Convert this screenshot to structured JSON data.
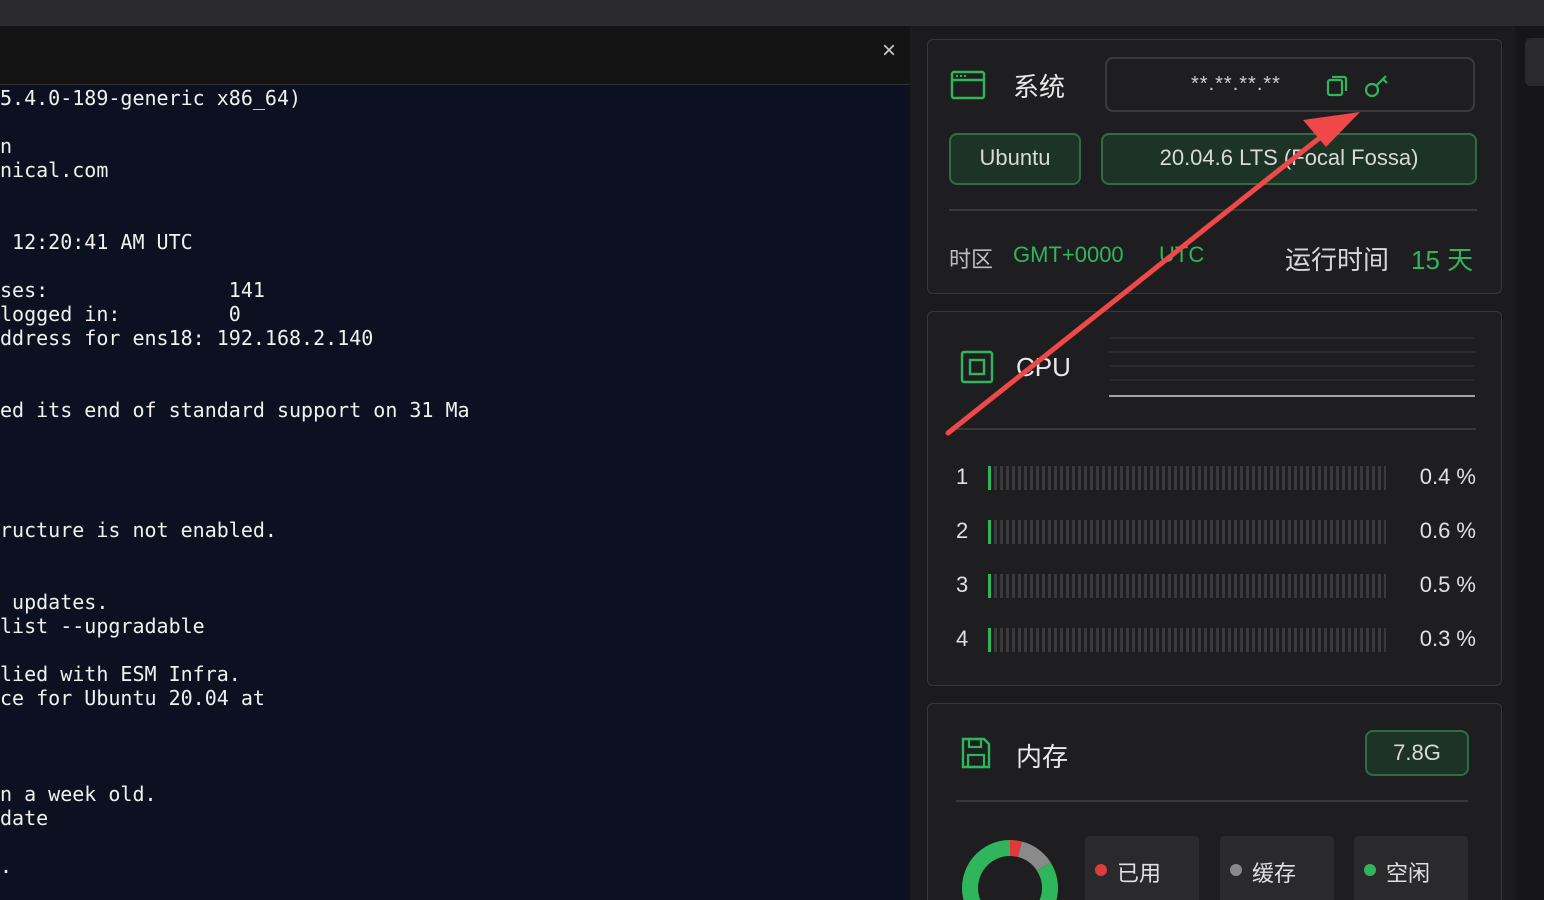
{
  "terminal": {
    "close_icon": "×",
    "lines": [
      "5.4.0-189-generic x86_64)",
      "n",
      "nical.com",
      " 12:20:41 AM UTC",
      "ses:               141",
      "logged in:         0",
      "ddress for ens18: 192.168.2.140",
      "ed its end of standard support on 31 Ma",
      "ructure is not enabled.",
      " updates.",
      "list --upgradable",
      "lied with ESM Infra.",
      "ce for Ubuntu 20.04 at",
      "n a week old.",
      "date",
      "."
    ]
  },
  "system": {
    "title": "系统",
    "ip_masked": "**.**.**.**",
    "os_name": "Ubuntu",
    "os_version": "20.04.6 LTS (Focal Fossa)",
    "timezone_label": "时区",
    "timezone_value": "GMT+0000",
    "timezone_name": "UTC",
    "uptime_label": "运行时间",
    "uptime_value": "15 天",
    "accent": "#2fb55b"
  },
  "cpu": {
    "title": "CPU",
    "cores": [
      {
        "index": "1",
        "pct": 0.4,
        "label": "0.4 %"
      },
      {
        "index": "2",
        "pct": 0.6,
        "label": "0.6 %"
      },
      {
        "index": "3",
        "pct": 0.5,
        "label": "0.5 %"
      },
      {
        "index": "4",
        "pct": 0.3,
        "label": "0.3 %"
      }
    ]
  },
  "memory": {
    "title": "内存",
    "total": "7.8G",
    "legend": [
      {
        "label": "已用",
        "color": "#e03a3a"
      },
      {
        "label": "缓存",
        "color": "#8a8a8a"
      },
      {
        "label": "空闲",
        "color": "#2fb55b"
      }
    ],
    "donut": {
      "used_fraction": 0.04,
      "cache_fraction": 0.12,
      "free_fraction": 0.84
    }
  },
  "icons": {
    "system": "browser-window-icon",
    "copy": "copy-icon",
    "key": "key-icon",
    "cpu": "cpu-chip-icon",
    "memory": "floppy-disk-icon"
  }
}
